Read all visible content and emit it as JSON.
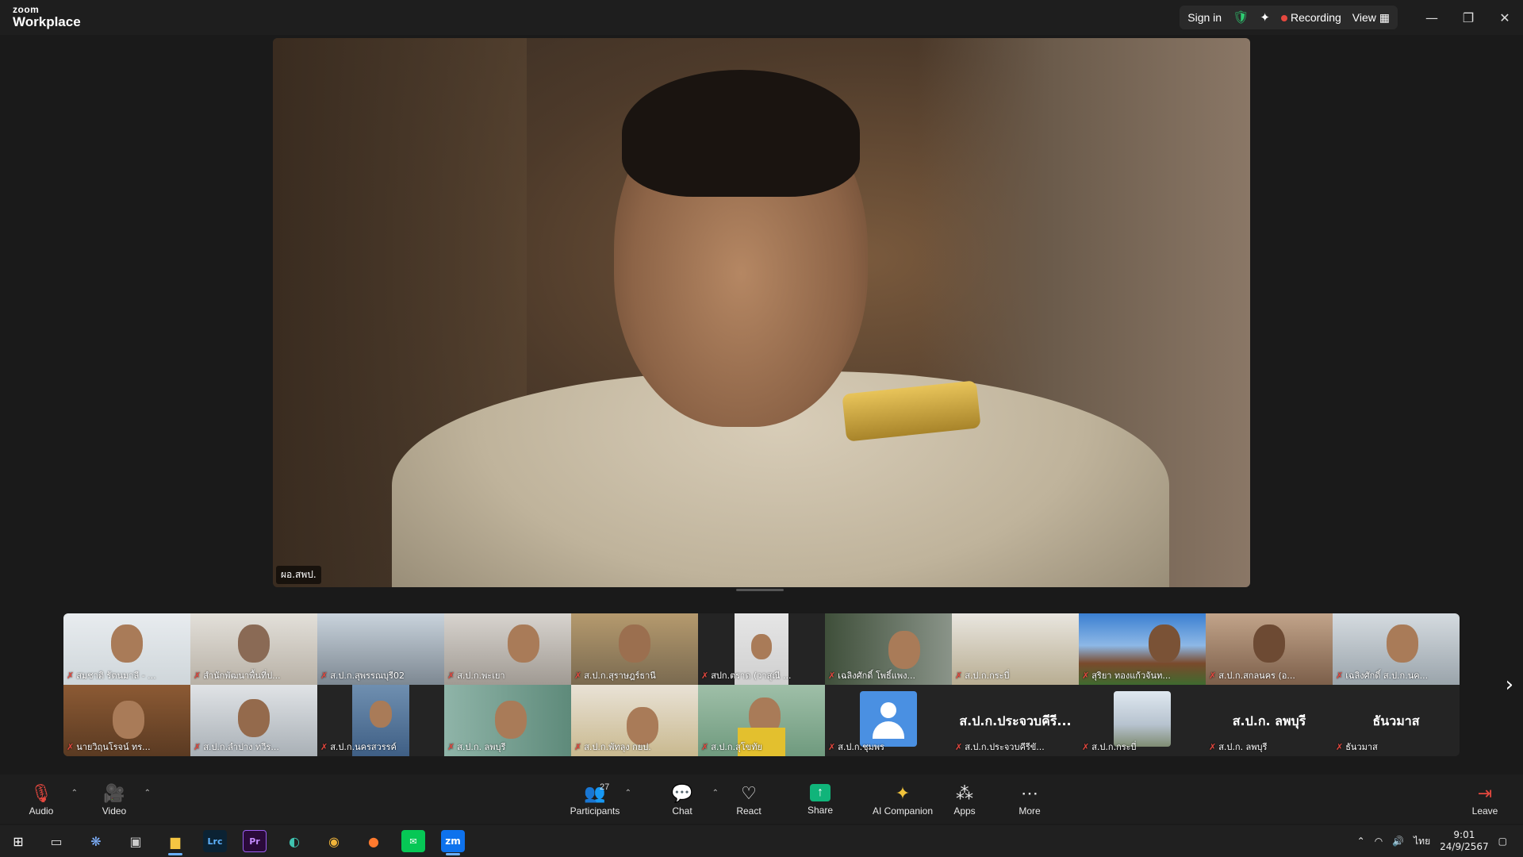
{
  "app": {
    "brand_top": "zoom",
    "brand_bottom": "Workplace"
  },
  "titlebar": {
    "sign_in": "Sign in",
    "recording": "Recording",
    "view": "View"
  },
  "main_video": {
    "name": "ผอ.สพป."
  },
  "gallery": {
    "row1": [
      "สมชาติ รัตนมาลี - ...",
      "สำนักพัฒนาพื้นที่ป...",
      "ส.ป.ก.สุพรรณบุรี02",
      "ส.ป.ก.พะเยา",
      "ส.ป.ก.สุราษฎร์ธานี",
      "สปก.ตราด (วาสุณี ...",
      "เฉลิงศักดิ์ โพธิ์แพง...",
      "ส.ป.ก.กระบี่",
      "สุริยา ทองแก้วจันท...",
      "ส.ป.ก.สกลนคร (อ...",
      "เฉลิงศักดิ์ ส.ป.ก.นค..."
    ],
    "row2": [
      "นายวิฤนโรจน์ ทร...",
      "ส.ป.ก.ลำปาง ทวีร...",
      "ส.ป.ก.นครสวรรค์",
      "ส.ป.ก. ลพบุรี",
      "ส.ป.ก.พัทลุง กยป.",
      "ส.ป.ก.สุโขทัย",
      "ส.ป.ก.ชุมพร",
      "ส.ป.ก.ประจวบคีรีขั...",
      "ส.ป.ก.กระบี่",
      "ส.ป.ก. ลพบุรี",
      "ธันวมาส"
    ],
    "big_names": {
      "t8": "ส.ป.ก.ประจวบคีรี...",
      "t10": "ส.ป.ก. ลพบุรี",
      "t11": "ธันวมาส"
    }
  },
  "toolbar": {
    "audio": "Audio",
    "video": "Video",
    "participants": "Participants",
    "participants_count": "27",
    "chat": "Chat",
    "react": "React",
    "share": "Share",
    "ai_companion": "AI Companion",
    "apps": "Apps",
    "more": "More",
    "leave": "Leave"
  },
  "taskbar": {
    "ime": "ไทย",
    "time": "9:01",
    "date": "24/9/2567",
    "lrc": "Lrc",
    "pr": "Pr",
    "zm": "zm"
  },
  "colors": {
    "recording": "#e5483f",
    "share": "#10b47a",
    "accent": "#0e72ed"
  }
}
